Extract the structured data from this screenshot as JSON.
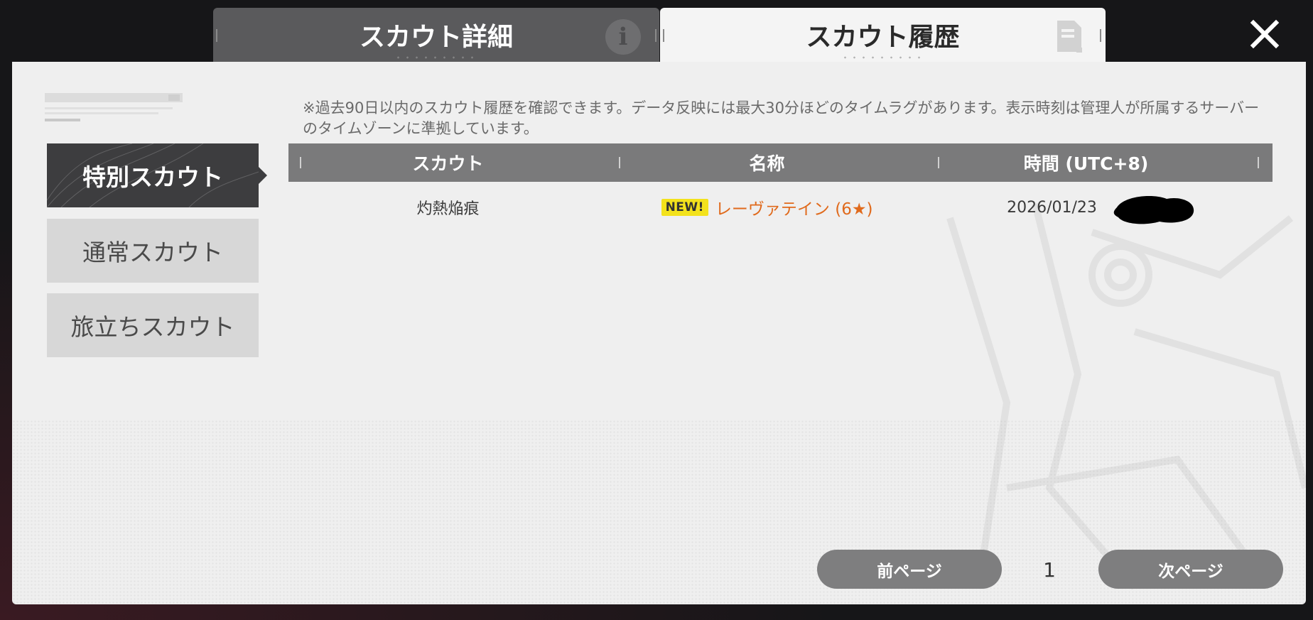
{
  "tabs": {
    "details_label": "スカウト詳細",
    "history_label": "スカウト履歴",
    "info_icon": "info-icon",
    "history_icon": "document-icon"
  },
  "close_icon": "close-icon",
  "sidebar": {
    "items": [
      {
        "label": "特別スカウト",
        "active": true
      },
      {
        "label": "通常スカウト",
        "active": false
      },
      {
        "label": "旅立ちスカウト",
        "active": false
      }
    ]
  },
  "notice": "※過去90日以内のスカウト履歴を確認できます。データ反映には最大30分ほどのタイムラグがあります。表示時刻は管理人が所属するサーバーのタイムゾーンに準拠しています。",
  "table": {
    "headers": [
      "スカウト",
      "名称",
      "時間 (UTC+8)"
    ],
    "rows": [
      {
        "scout": "灼熱焔痕",
        "badge": "NEW!",
        "name": "レーヴァテイン (6★)",
        "time": "2026/01/23"
      }
    ]
  },
  "pager": {
    "prev_label": "前ページ",
    "page": "1",
    "next_label": "次ページ"
  },
  "colors": {
    "accent_name": "#e06a1c",
    "badge_bg": "#f3e21c",
    "active_side": "#3d3d3f",
    "header_bg": "#7a7a7b"
  }
}
